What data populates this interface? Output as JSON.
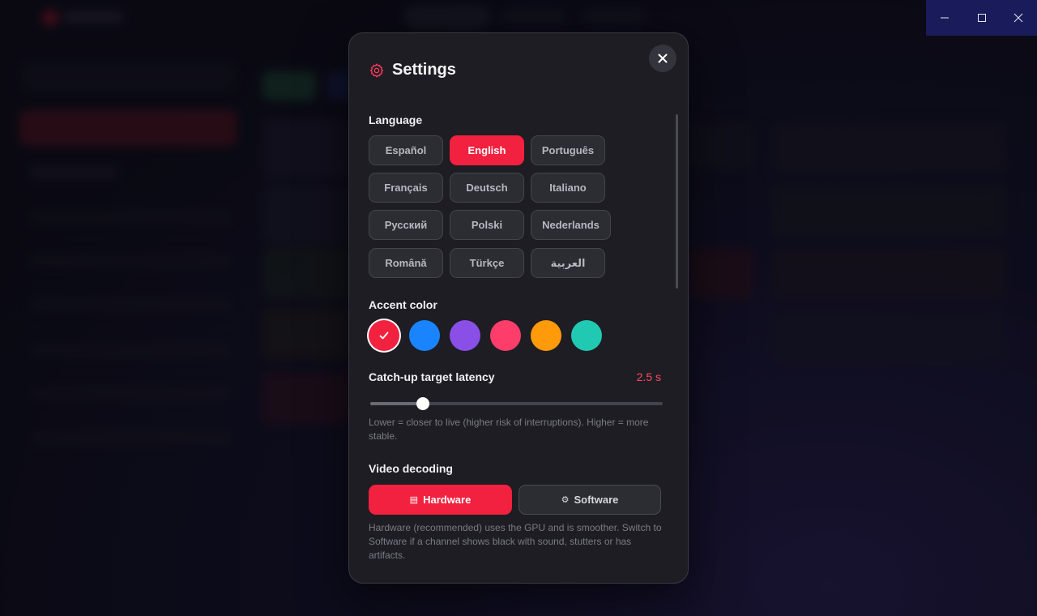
{
  "window": {
    "minimize_icon": "minimize-icon",
    "maximize_icon": "maximize-icon",
    "close_icon": "close-icon"
  },
  "settings": {
    "title": "Settings",
    "language": {
      "label": "Language",
      "options": [
        "Español",
        "English",
        "Português",
        "Français",
        "Deutsch",
        "Italiano",
        "Русский",
        "Polski",
        "Nederlands",
        "Română",
        "Türkçe",
        "العربية"
      ],
      "selected": "English"
    },
    "accent": {
      "label": "Accent color",
      "colors": [
        "#f2213f",
        "#1a84ff",
        "#8a4fe6",
        "#ff3d6a",
        "#ff9a0a",
        "#22c9b2"
      ],
      "selected_index": 0
    },
    "latency": {
      "label": "Catch-up target latency",
      "value": "2.5 s",
      "level": 0.18,
      "help": "Lower = closer to live (higher risk of interruptions). Higher = more stable."
    },
    "decoding": {
      "label": "Video decoding",
      "hardware_label": "Hardware",
      "software_label": "Software",
      "selected": "Hardware",
      "help": "Hardware (recommended) uses the GPU and is smoother. Switch to Software if a channel shows black with sound, stutters or has artifacts."
    }
  },
  "colors": {
    "accent": "#f2213f",
    "latency_text": "#ff4a63"
  }
}
